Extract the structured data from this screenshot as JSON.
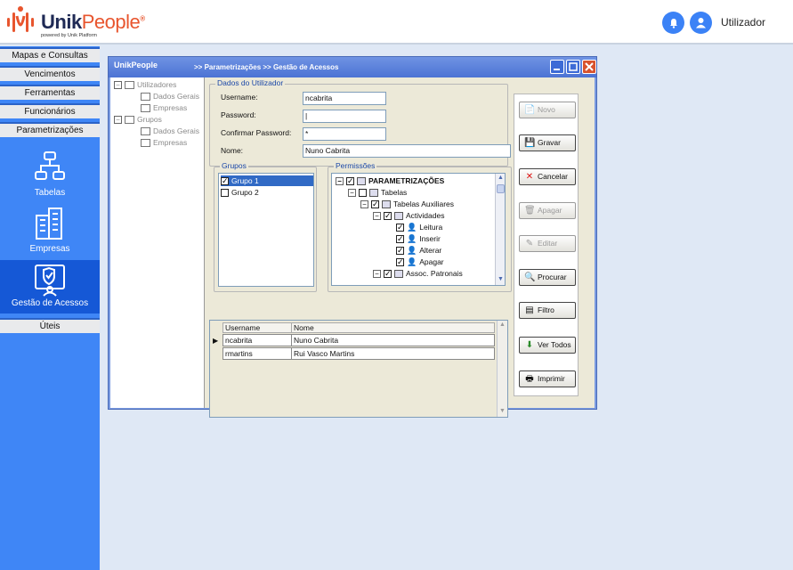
{
  "header": {
    "brand": {
      "unik": "Unik",
      "people": "People",
      "registered": "®",
      "tagline": "powered by Unik Platform"
    },
    "user_label": "Utilizador",
    "icons": {
      "notifications": "bell-icon",
      "user": "user-circle-icon"
    },
    "colors": {
      "accent": "#3b82f6",
      "brand_dark": "#1f2a55",
      "brand_orange": "#e8552e"
    }
  },
  "sidebar": {
    "menu": [
      "Mapas e Consultas",
      "Vencimentos",
      "Ferramentas",
      "Funcionários",
      "Parametrizações"
    ],
    "tiles": [
      {
        "label": "Tabelas",
        "icon": "hierarchy-icon"
      },
      {
        "label": "Empresas",
        "icon": "buildings-icon"
      },
      {
        "label": "Gestão de Acessos",
        "icon": "access-management-icon"
      }
    ],
    "bottom": "Úteis",
    "active_tile": "Gestão de Acessos",
    "colors": {
      "bg": "#3f86f6",
      "active": "#1558d6"
    }
  },
  "window": {
    "logo": "UnikPeople",
    "breadcrumb": ">> Parametrizações  >> Gestão de Acessos",
    "tree": [
      {
        "label": "Utilizadores",
        "level": 0
      },
      {
        "label": "Dados Gerais",
        "level": 1
      },
      {
        "label": "Empresas",
        "level": 1
      },
      {
        "label": "Grupos",
        "level": 0
      },
      {
        "label": "Dados Gerais",
        "level": 1
      },
      {
        "label": "Empresas",
        "level": 1
      }
    ],
    "form": {
      "legend": "Dados do Utilizador",
      "username_label": "Username:",
      "username_value": "ncabrita",
      "password_label": "Password:",
      "password_value": "|",
      "confirm_label": "Confirmar Password:",
      "confirm_value": "*",
      "nome_label": "Nome:",
      "nome_value": "Nuno Cabrita"
    },
    "grupos": {
      "legend": "Grupos",
      "items": [
        {
          "label": "Grupo 1",
          "checked": true,
          "selected": true
        },
        {
          "label": "Grupo 2",
          "checked": false,
          "selected": false
        }
      ]
    },
    "permissoes": {
      "legend": "Permissões",
      "items": [
        {
          "label": "PARAMETRIZAÇÕES",
          "level": 0,
          "expander": "−",
          "checked": true
        },
        {
          "label": "Tabelas",
          "level": 1,
          "expander": "−",
          "checked": false
        },
        {
          "label": "Tabelas Auxiliares",
          "level": 2,
          "expander": "−",
          "checked": true
        },
        {
          "label": "Actividades",
          "level": 3,
          "expander": "−",
          "checked": true
        },
        {
          "label": "Leitura",
          "level": 4,
          "expander": "",
          "checked": true
        },
        {
          "label": "Inserir",
          "level": 4,
          "expander": "",
          "checked": true
        },
        {
          "label": "Alterar",
          "level": 4,
          "expander": "",
          "checked": true
        },
        {
          "label": "Apagar",
          "level": 4,
          "expander": "",
          "checked": true
        },
        {
          "label": "Assoc. Patronais",
          "level": 3,
          "expander": "−",
          "checked": true
        }
      ]
    },
    "grid": {
      "headers": [
        "Username",
        "Nome"
      ],
      "rows": [
        {
          "current": true,
          "username": "ncabrita",
          "nome": "Nuno Cabrita"
        },
        {
          "current": false,
          "username": "rmartins",
          "nome": "Rui Vasco Martins"
        }
      ]
    },
    "buttons": [
      {
        "label": "Novo",
        "icon": "new-document-icon",
        "enabled": false
      },
      {
        "label": "Gravar",
        "icon": "save-icon",
        "enabled": true
      },
      {
        "label": "Cancelar",
        "icon": "cancel-icon",
        "enabled": true
      },
      {
        "label": "Apagar",
        "icon": "delete-icon",
        "enabled": false
      },
      {
        "label": "Editar",
        "icon": "edit-icon",
        "enabled": false
      },
      {
        "label": "Procurar",
        "icon": "search-icon",
        "enabled": true
      },
      {
        "label": "Filtro",
        "icon": "filter-icon",
        "enabled": true
      },
      {
        "label": "Ver Todos",
        "icon": "view-all-icon",
        "enabled": true
      },
      {
        "label": "Imprimir",
        "icon": "print-icon",
        "enabled": true
      }
    ]
  }
}
